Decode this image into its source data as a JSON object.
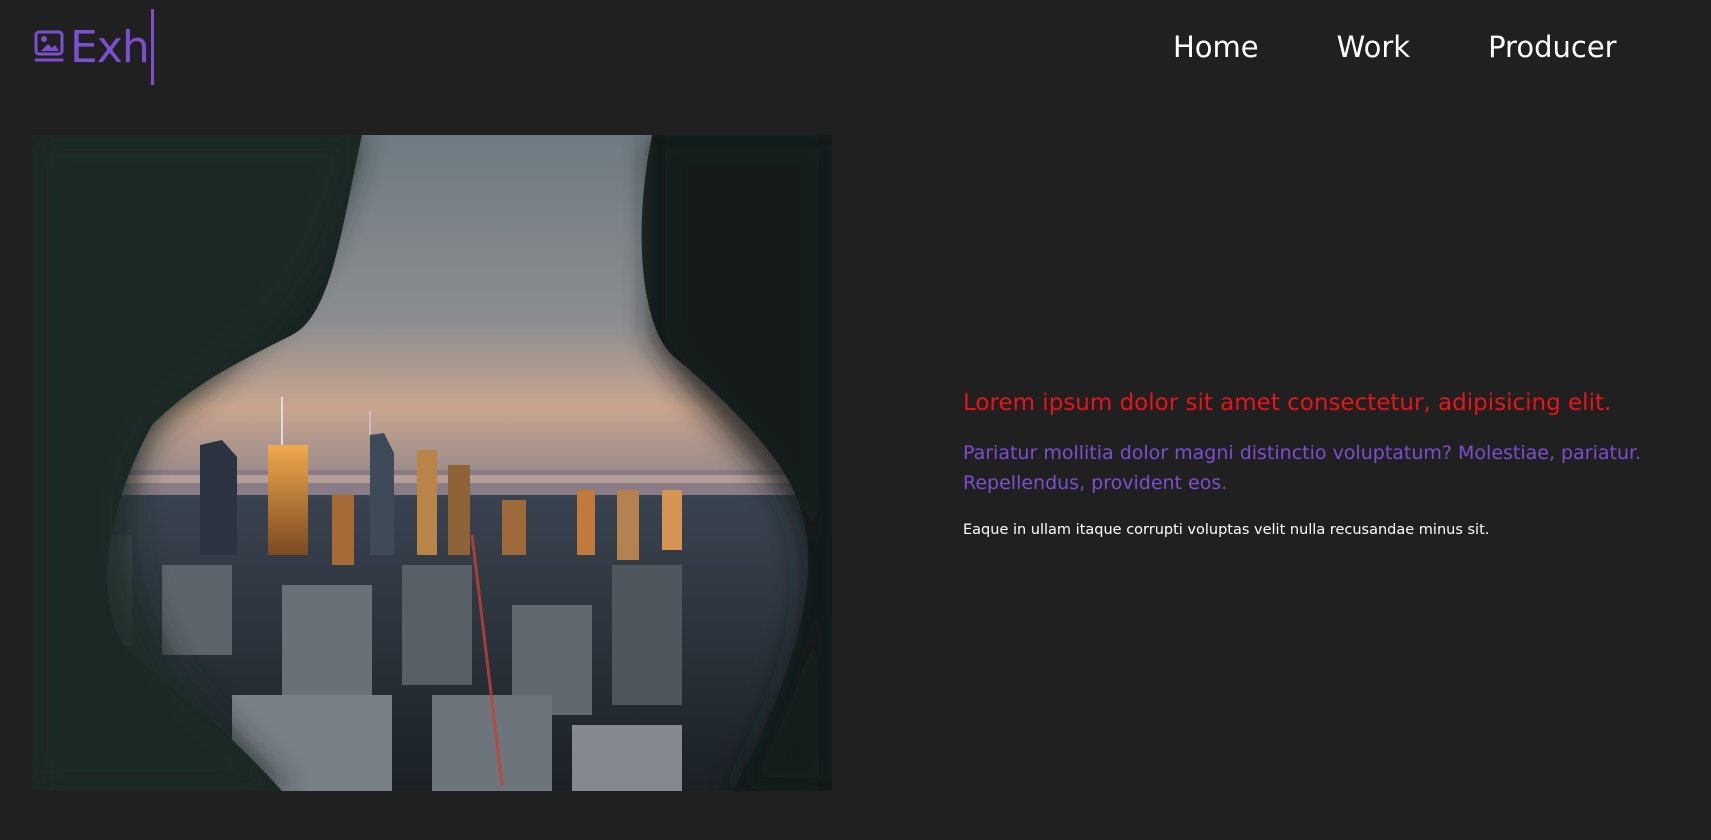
{
  "brand": {
    "name": "Exh",
    "icon": "image-frame-icon",
    "color": "#7b4fd0"
  },
  "nav": {
    "items": [
      {
        "label": "Home"
      },
      {
        "label": "Work"
      },
      {
        "label": "Producer"
      }
    ]
  },
  "hero": {
    "image": "city-skyline-through-rock-opening",
    "headline": "Lorem ipsum dolor sit amet consectetur, adipisicing elit.",
    "subheadline": "Pariatur mollitia dolor magni distinctio voluptatum? Molestiae, pariatur. Repellendus, provident eos.",
    "body": "Eaque in ullam itaque corrupti voluptas velit nulla recusandae minus sit."
  },
  "colors": {
    "background": "#202020",
    "headline": "#e8141a",
    "subheadline": "#7b4fd0",
    "body": "#ffffff",
    "nav": "#ffffff"
  }
}
